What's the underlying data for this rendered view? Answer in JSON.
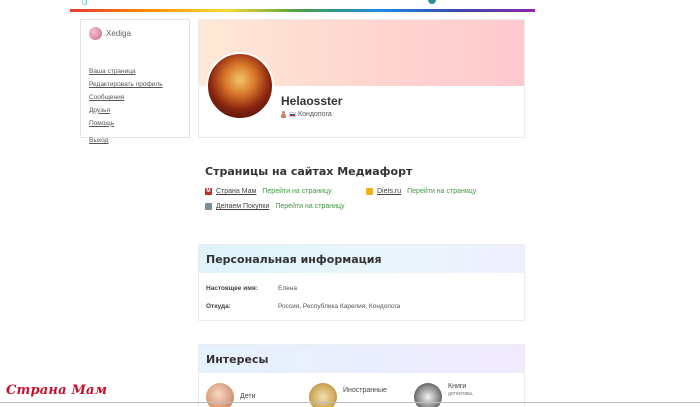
{
  "profile": {
    "username": "Helaosster",
    "location": "Кондопога"
  },
  "sidebar": {
    "user_name": "Xediga",
    "items": [
      {
        "label": "Ваша страница"
      },
      {
        "label": "Редактировать профиль"
      },
      {
        "label": "Сообщения"
      },
      {
        "label": "Друзья"
      },
      {
        "label": "Помощь"
      }
    ],
    "exit_label": "Выход"
  },
  "sites": {
    "title": "Страницы на сайтах Медиафорт",
    "items": [
      {
        "name": "Страна Мам",
        "link": "Перейти на страницу",
        "icon": "strana-mam-icon",
        "icon_letter": "М"
      },
      {
        "name": "Diets.ru",
        "link": "Перейти на страницу",
        "icon": "diets-icon"
      },
      {
        "name": "Делаем Покупки",
        "link": "Перейти на страницу",
        "icon": "delaem-pokupki-icon"
      }
    ]
  },
  "personal": {
    "title": "Персональная информация",
    "rows": [
      {
        "label": "Настоящее имя:",
        "value": "Елена"
      },
      {
        "label": "Откуда:",
        "value": "Россия, Республика Карелия, Кондопога"
      }
    ]
  },
  "interests": {
    "title": "Интересы",
    "items": [
      {
        "label": "Дети",
        "sub": ""
      },
      {
        "label": "Иностранные",
        "sub": ""
      },
      {
        "label": "Книги",
        "sub": "детективы,"
      }
    ]
  },
  "watermark": "Страна Мам",
  "colors": {
    "link_green": "#3f9a3f",
    "watermark_red": "#c8102e"
  }
}
